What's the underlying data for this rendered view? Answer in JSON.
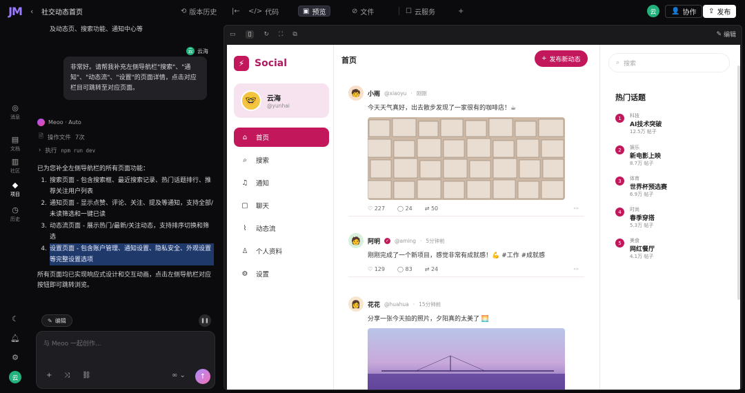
{
  "topbar": {
    "crumb": "社交动态首页",
    "history": "版本历史",
    "code": "代码",
    "preview": "预览",
    "files": "文件",
    "cloud": "云服务",
    "collab": "协作",
    "publish": "发布",
    "user_initial": "云"
  },
  "rail": [
    {
      "icon": "chat-icon",
      "label": "消息"
    },
    {
      "icon": "file-icon",
      "label": "文档"
    },
    {
      "icon": "group-icon",
      "label": "社区"
    },
    {
      "icon": "cube-icon",
      "label": "项目"
    },
    {
      "icon": "history-icon",
      "label": "历史"
    }
  ],
  "chat": {
    "top_line": "及动态页、搜索功能、通知中心等",
    "user_name": "云海",
    "user_bubble": "非常好。请帮我补充左侧导航栏\"搜索\"、\"通知\"、\"动态流\"、\"设置\"的页面详情，点击对应栏目可跳转至对应页面。",
    "agent_name": "Meoo · Auto",
    "op_label": "操作文件",
    "op_count": "7次",
    "exec_label": "执行",
    "exec_cmd": "npm run dev",
    "intro": "已为您补全左侧导航栏的所有页面功能：",
    "items": [
      {
        "num": "1.",
        "text": "搜索页面 - 包含搜索框、最近搜索记录、热门话题排行、推荐关注用户列表"
      },
      {
        "num": "2.",
        "text": "通知页面 - 显示点赞、评论、关注、提及等通知，支持全部/未读筛选和一键已读"
      },
      {
        "num": "3.",
        "text": "动态流页面 - 展示热门/最新/关注动态，支持排序切换和筛选"
      },
      {
        "num": "4.",
        "text": "设置页面 - 包含账户管理、通知设置、隐私安全、外观设置等完整设置选项"
      }
    ],
    "outro": "所有页面均已实现响应式设计和交互动画，点击左侧导航栏对应按钮即可跳转浏览。",
    "edit_chip": "编辑",
    "placeholder": "与 Meoo 一起创作..."
  },
  "preview": {
    "edit_label": "编辑"
  },
  "site": {
    "brand": "Social",
    "profile_name": "云海",
    "profile_handle": "@yunhai",
    "nav": [
      "首页",
      "搜索",
      "通知",
      "聊天",
      "动态流",
      "个人资料",
      "设置"
    ],
    "feed_title": "首页",
    "new_post": "发布新动态",
    "posts": [
      {
        "author": "小雨",
        "handle": "@xiaoyu",
        "time": "刚刚",
        "text": "今天天气真好，出去散步发现了一家很有的咖啡店！☕",
        "likes": "227",
        "comments": "24",
        "shares": "50"
      },
      {
        "author": "阿明",
        "handle": "@aming",
        "time": "5分钟前",
        "text": "刚刚完成了一个新项目，感觉非常有成就感！💪 #工作 #成就感",
        "likes": "129",
        "comments": "83",
        "shares": "24"
      },
      {
        "author": "花花",
        "handle": "@huahua",
        "time": "15分钟前",
        "text": "分享一张今天拍的照片，夕阳真的太美了 🌅"
      }
    ],
    "search_placeholder": "搜索",
    "trend_title": "热门话题",
    "trends": [
      {
        "num": "1",
        "category": "科技",
        "name": "AI技术突破",
        "count": "12.5万 帖子"
      },
      {
        "num": "2",
        "category": "娱乐",
        "name": "新电影上映",
        "count": "8.7万 帖子"
      },
      {
        "num": "3",
        "category": "体育",
        "name": "世界杯预选赛",
        "count": "6.9万 帖子"
      },
      {
        "num": "4",
        "category": "时尚",
        "name": "春季穿搭",
        "count": "5.3万 帖子"
      },
      {
        "num": "5",
        "category": "美食",
        "name": "网红餐厅",
        "count": "4.1万 帖子"
      }
    ]
  },
  "colors": {
    "accent": "#c2185b",
    "card_tint": "#f7e3f0",
    "dark_bg": "#0b0b0d"
  }
}
